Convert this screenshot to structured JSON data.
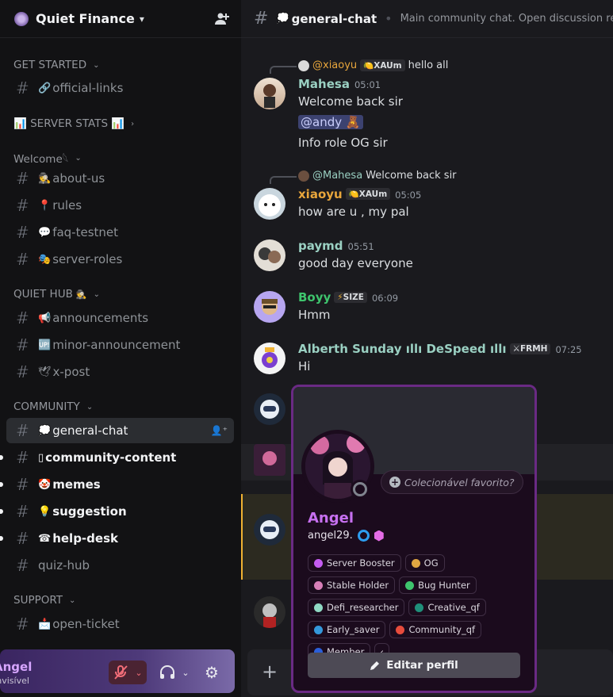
{
  "server": {
    "name": "Quiet Finance"
  },
  "categories": {
    "get_started": "GET STARTED",
    "server_stats": "📊 SERVER STATS 📊",
    "welcome": "Welcome𓆩",
    "quiet_hub": "QUIET HUB",
    "community": "COMMUNITY",
    "support": "SUPPORT"
  },
  "channels": {
    "official_links": "official-links",
    "about_us": "about-us",
    "rules": "rules",
    "faq_testnet": "faq-testnet",
    "server_roles": "server-roles",
    "announcements": "announcements",
    "minor_announcement": "minor-announcement",
    "x_post": "x-post",
    "general_chat": "general-chat",
    "community_content": "community-content",
    "memes": "memes",
    "suggestion": "suggestion",
    "help_desk": "help-desk",
    "quiz_hub": "quiz-hub",
    "open_ticket": "open-ticket"
  },
  "user": {
    "name": "Angel",
    "status": "Invisível"
  },
  "topbar": {
    "channel": "general-chat",
    "topic": "Main community chat. Open discussion related t"
  },
  "messages": [
    {
      "reply_user": "@xiaoyu",
      "reply_tag": "XAUm",
      "reply_text": "hello  all",
      "author": "Mahesa",
      "time": "05:01",
      "lines": [
        "Welcome back sir",
        "@andy 🧸",
        "Info role OG sir"
      ]
    },
    {
      "reply_user": "@Mahesa",
      "reply_text": "Welcome back sir",
      "author": "xiaoyu",
      "tag": "XAUm",
      "time": "05:05",
      "lines": [
        "how are u ,  my pal"
      ]
    },
    {
      "author": "paymd",
      "time": "05:51",
      "lines": [
        "good day everyone"
      ]
    },
    {
      "author": "Boyy",
      "tag": "SIZE",
      "time": "06:09",
      "lines": [
        "Hmm"
      ]
    },
    {
      "author": "Alberth Sunday ıllı DeSpeed ıllı",
      "tag": "FRMH",
      "time": "07:25",
      "lines": [
        "Hi"
      ]
    }
  ],
  "popup": {
    "fav_placeholder": "Colecionável favorito?",
    "display_name": "Angel",
    "username": "angel29.",
    "roles": [
      {
        "name": "Server Booster",
        "color": "#c45cf0"
      },
      {
        "name": "OG",
        "color": "#e0a642"
      },
      {
        "name": "Stable Holder",
        "color": "#d87fb8"
      },
      {
        "name": "Bug Hunter",
        "color": "#3ec46d"
      },
      {
        "name": "Defi_researcher",
        "color": "#8fd8c3"
      },
      {
        "name": "Creative_qf",
        "color": "#1f8f7a"
      },
      {
        "name": "Early_saver",
        "color": "#3498db"
      },
      {
        "name": "Community_qf",
        "color": "#e74c3c"
      },
      {
        "name": "Member",
        "color": "#2b5fd9"
      }
    ],
    "edit_label": "Editar perfil"
  },
  "colors": {
    "mahesa": "#9ad0c2",
    "xiaoyu": "#e8a63c",
    "paymd": "#9ad0c2",
    "boyy": "#3ec46d",
    "alberth": "#9ad0c2",
    "accent_purple": "#c770f0"
  }
}
